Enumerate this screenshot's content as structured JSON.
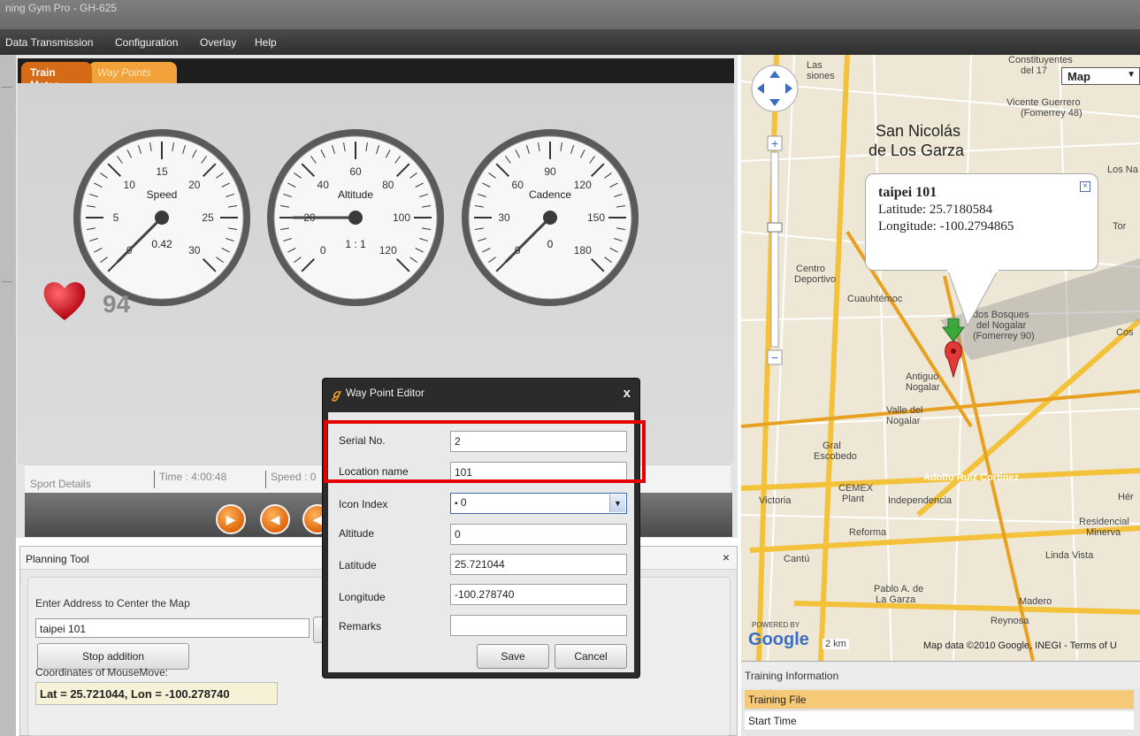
{
  "window": {
    "title": "ning Gym Pro - GH-625"
  },
  "menu": [
    "Data Transmission",
    "Configuration",
    "Overlay",
    "Help"
  ],
  "tabs": {
    "active": "Train Meter",
    "inactive": "Way Points"
  },
  "gauges": [
    {
      "name": "Speed",
      "value": "0.42",
      "ticks": [
        "5",
        "10",
        "15",
        "20",
        "25",
        "30"
      ],
      "zero": "0",
      "needle_value": 0
    },
    {
      "name": "Altitude",
      "value": "1 : 1",
      "ticks": [
        "20",
        "40",
        "60",
        "80",
        "100",
        "120"
      ],
      "zero": "0",
      "needle_value": 20
    },
    {
      "name": "Cadence",
      "value": "0",
      "ticks": [
        "30",
        "60",
        "90",
        "120",
        "150",
        "180"
      ],
      "zero": "0",
      "needle_value": 0
    }
  ],
  "heart_rate": "94",
  "sport_details": {
    "label": "Sport Details",
    "time": "Time : 4:00:48",
    "speed": "Speed : 0"
  },
  "planning": {
    "title": "Planning Tool",
    "close": "×",
    "address_label": "Enter Address to Center the Map",
    "address_value": "taipei 101",
    "stop_button": "Stop addition",
    "coords_label": "Coordinates of MouseMove:",
    "coords_value": "Lat = 25.721044, Lon = -100.278740"
  },
  "map": {
    "type_select": "Map",
    "labels": {
      "city": "San Nicolás",
      "city2": "de Los Garza",
      "l1": "Las",
      "l2": "siones",
      "l3": "Constituyentes",
      "l4": "del 17",
      "l5": "Vicente Guerrero",
      "l6": "(Fomerrey 48)",
      "l7": "Centro",
      "l8": "Deportivo",
      "l9": "Cuauhtémoc",
      "l10": "dos Bosques",
      "l11": "del Nogalar",
      "l12": "(Fomerrey 90)",
      "l13": "Antiguo",
      "l14": "Nogalar",
      "l15": "Valle del",
      "l16": "Nogalar",
      "l17": "Gral",
      "l18": "Escobedo",
      "l19": "Adolfo Ruiz Cortinez",
      "l20": "Victoria",
      "l21": "CEMEX",
      "l22": "Plant",
      "l23": "Independencia",
      "l24": "Reforma",
      "l25": "Residencial",
      "l26": "Minerva",
      "l27": "Cantú",
      "l28": "Linda Vista",
      "l29": "Pablo A. de",
      "l30": "La Garza",
      "l31": "Madero",
      "l32": "Reynosa",
      "l33": "Los Na",
      "l34": "Hér",
      "l35": "Cos",
      "l36": "Tor",
      "attribution": "Map data ©2010 Google, INEGI - Terms of U",
      "scale": "2 km",
      "powered": "POWERED BY"
    },
    "info": {
      "title": "taipei 101",
      "lat": "Latitude: 25.7180584",
      "lon": "Longitude: -100.2794865",
      "close": "×"
    }
  },
  "training_info": {
    "title": "Training Information",
    "rows": [
      "Training File",
      "Start Time"
    ]
  },
  "dialog": {
    "title": "Way Point Editor",
    "close": "x",
    "fields": {
      "serial_label": "Serial No.",
      "serial": "2",
      "location_label": "Location name",
      "location": "101",
      "icon_label": "Icon Index",
      "icon": "0",
      "altitude_label": "Altitude",
      "altitude": "0",
      "latitude_label": "Latitude",
      "latitude": "25.721044",
      "longitude_label": "Longitude",
      "longitude": "-100.278740",
      "remarks_label": "Remarks",
      "remarks": ""
    },
    "save": "Save",
    "cancel": "Cancel"
  },
  "colors": {
    "accent_orange": "#e0660c",
    "highlight_red": "#e60000",
    "heart_red": "#d0121b"
  }
}
